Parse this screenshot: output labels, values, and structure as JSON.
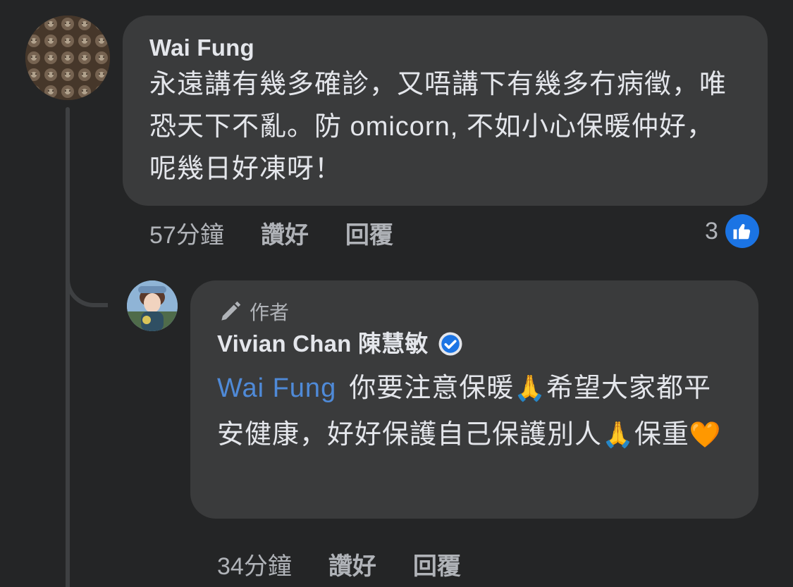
{
  "main_comment": {
    "author": "Wai Fung",
    "text": "永遠講有幾多確診，又唔講下有幾多冇病徵，唯恐天下不亂。防 omicorn, 不如小心保暖仲好，呢幾日好凍呀！",
    "time": "57分鐘",
    "like_label": "讚好",
    "reply_label": "回覆",
    "reaction_count": "3",
    "reaction_icon": "like-icon"
  },
  "reply_comment": {
    "badge_label": "作者",
    "badge_icon": "pen-icon",
    "author": "Vivian Chan 陳慧敏",
    "verified_icon": "verified-badge-icon",
    "mention": "Wai Fung",
    "text_part1": "你要注意保暖",
    "emoji1": "🙏",
    "text_part2": "希望大家都平安健康，好好保護自己保護別人",
    "emoji2": "🙏",
    "text_part3": "保重",
    "emoji3": "🧡",
    "time": "34分鐘",
    "like_label": "讚好",
    "reply_label": "回覆"
  },
  "colors": {
    "background": "#242526",
    "bubble": "#3a3b3c",
    "text_primary": "#e4e6eb",
    "text_secondary": "#b0b3b8",
    "mention": "#4f8ad8",
    "like_blue": "#1b74e4"
  }
}
